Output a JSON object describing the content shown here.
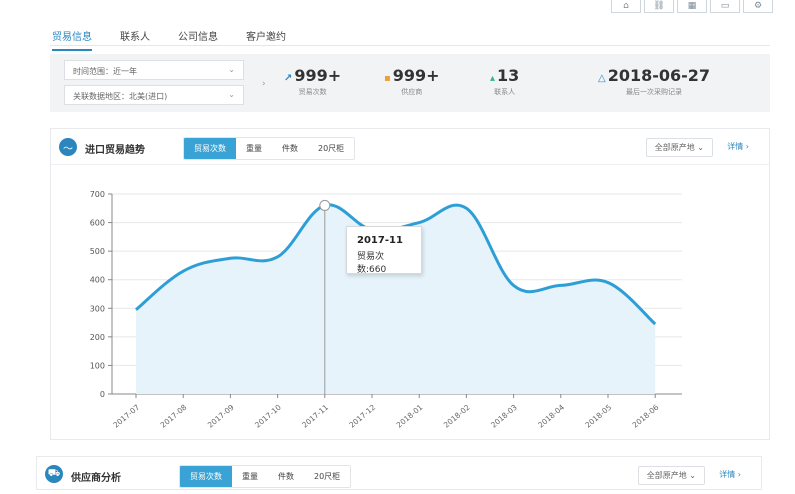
{
  "tabs": [
    {
      "label": "贸易信息",
      "active": true
    },
    {
      "label": "联系人",
      "active": false
    },
    {
      "label": "公司信息",
      "active": false
    },
    {
      "label": "客户邀约",
      "active": false
    }
  ],
  "summary": {
    "time_range_label": "时间范围：近一年",
    "region_label": "关联数据地区：北美(进口)",
    "stats": [
      {
        "icon": "trend-icon",
        "value": "999+",
        "label": "贸易次数"
      },
      {
        "icon": "box-icon",
        "value": "999+",
        "label": "供应商"
      },
      {
        "icon": "user-icon",
        "value": "13",
        "label": "联系人"
      },
      {
        "icon": "bell-icon",
        "value": "2018-06-27",
        "label": "最后一次采购记录"
      }
    ]
  },
  "trend_panel": {
    "title": "进口贸易趋势",
    "segments": [
      "贸易次数",
      "重量",
      "件数",
      "20尺柜"
    ],
    "active_segment": "贸易次数",
    "origin_select": "全部原产地",
    "detail_link": "详情",
    "tooltip": {
      "title": "2017-11",
      "line": "贸易次数:660"
    }
  },
  "supplier_panel": {
    "title": "供应商分析",
    "segments": [
      "贸易次数",
      "重量",
      "件数",
      "20尺柜"
    ],
    "active_segment": "贸易次数",
    "origin_select": "全部原产地",
    "detail_link": "详情"
  },
  "chart_data": {
    "type": "area",
    "categories": [
      "2017-07",
      "2017-08",
      "2017-09",
      "2017-10",
      "2017-11",
      "2017-12",
      "2018-01",
      "2018-02",
      "2018-03",
      "2018-04",
      "2018-05",
      "2018-06"
    ],
    "series": [
      {
        "values": [
          295,
          430,
          475,
          480,
          660,
          575,
          600,
          650,
          380,
          380,
          390,
          245
        ]
      }
    ],
    "ylim": [
      0,
      700
    ],
    "yticks": [
      0,
      100,
      200,
      300,
      400,
      500,
      600,
      700
    ],
    "highlight_index": 4,
    "line_color": "#2e9fd6",
    "fill_color": "#e6f3fb",
    "grid": true
  }
}
